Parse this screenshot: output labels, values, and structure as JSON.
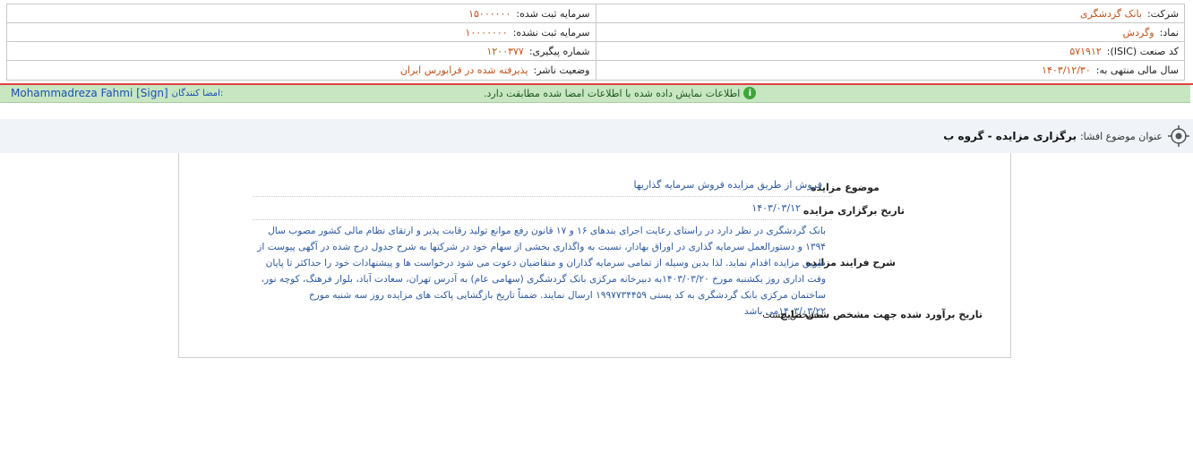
{
  "header": {
    "company_label": "شرکت:",
    "company_value": "بانک گردشگری",
    "registered_capital_label": "سرمایه ثبت شده:",
    "registered_capital_value": "۱۵۰۰۰۰۰۰",
    "symbol_label": "نماد:",
    "symbol_value": "وگردش",
    "unregistered_capital_label": "سرمایه ثبت نشده:",
    "unregistered_capital_value": "۱۰۰۰۰۰۰۰",
    "isic_label": "کد صنعت (ISIC):",
    "isic_value": "۵۷۱۹۱۲",
    "tracking_label": "شماره پیگیری:",
    "tracking_value": "۱۲۰۰۳۷۷",
    "fiscal_year_label": "سال مالی منتهی به:",
    "fiscal_year_value": "۱۴۰۳/۱۲/۳۰",
    "publisher_status_label": "وضعیت ناشر:",
    "publisher_status_value": "پذیرفته شده در فرابورس ایران"
  },
  "verification": {
    "message": "اطلاعات نمایش داده شده با اطلاعات امضا شده مطابقت دارد.",
    "signers_label": "امضا کنندگان:",
    "signer_name": "Mohammadreza Fahmi [Sign]"
  },
  "disclosure": {
    "subject_label": "عنوان موضوع افشا:",
    "subject_value": "برگزاری مزایده - گروه ب"
  },
  "auction": {
    "topic_label": "موضوع مزایده",
    "topic_value": "فروش از طریق مزایده فروش سرمایه گذاریها",
    "date_label": "تاریخ برگزاری مزایده",
    "date_value": "۱۴۰۳/۰۳/۱۲",
    "process_label": "شرح فرایند مزایده",
    "process_value": "بانک گردشگری در نظر دارد در راستای رعایت اجرای بندهای ۱۶ و ۱۷ قانون رفع موانع تولید رقابت پذیر و ارتقای نظام مالی کشور مصوب سال ۱۳۹۴ و دستورالعمل سرمایه گذاری در اوراق بهادار، نسبت به واگذاری بخشی از سهام خود در شرکتها به شرح جدول درج شده در آگهی پیوست از طریق مزایده اقدام نماید. لذا بدین وسیله از تمامی سرمایه گذاران و متقاضیان دعوت می شود درخواست ها و پیشنهادات خود را حداکثر تا پایان وقت اداری روز یکشنبه مورخ ۱۴۰۳/۰۳/۲۰به دبیرخانه مرکزی بانک گردشگری (سهامی عام) به آدرس تهران، سعادت آباد، بلوار فرهنگ، کوچه نور، ساختمان مرکزی بانک گردشگری به کد پستی ۱۹۹۷۷۳۴۴۵۹ ارسال نمایند. ضمناً تاریخ بازگشایی پاکت های مزایده روز سه شنبه مورخ ۱۴۰۳/۰۳/۲۲می باشد",
    "results_date_label": "تاریخ برآورد شده جهت مشخص شدن نتایج",
    "results_date_value": "مشخص نیست"
  },
  "colors": {
    "value_orange": "#c0521b",
    "value_blue": "#2c5aa0",
    "verify_bg": "#c8e6c2",
    "red_line": "#e04040"
  },
  "icons": {
    "info": "info-icon",
    "target": "target-icon"
  }
}
